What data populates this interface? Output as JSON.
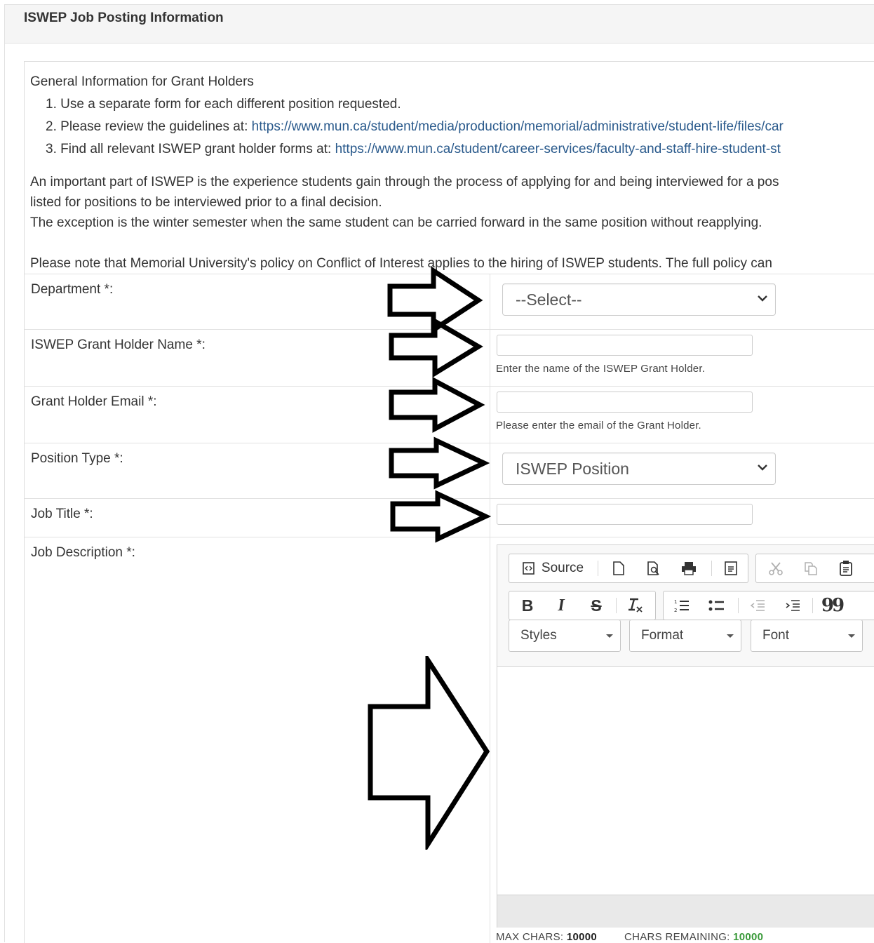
{
  "panel": {
    "title": "ISWEP Job Posting Information"
  },
  "info": {
    "heading": "General Information for Grant Holders",
    "items": [
      {
        "num": "1.",
        "text": "Use a separate form for each different position requested.",
        "link": ""
      },
      {
        "num": "2.",
        "text": "Please review the guidelines at: ",
        "link": "https://www.mun.ca/student/media/production/memorial/administrative/student-life/files/car"
      },
      {
        "num": "3.",
        "text": "Find all relevant ISWEP grant holder forms at: ",
        "link": "https://www.mun.ca/student/career-services/faculty-and-staff-hire-student-st"
      }
    ],
    "para1_line1": "An important part of ISWEP is the experience students gain through the process of applying for and being interviewed for a pos",
    "para1_line2": "listed for positions to be interviewed prior to a final decision.",
    "para1_line3": "The exception is the winter semester when the same student can be carried forward in the same position without reapplying.",
    "para2": "Please note that Memorial University's policy on Conflict of Interest applies to the hiring of ISWEP students.  The full policy can"
  },
  "fields": {
    "department": {
      "label": "Department *:",
      "selected": "--Select--"
    },
    "grant_holder_name": {
      "label": "ISWEP Grant Holder Name *:",
      "value": "",
      "help": "Enter the name of the ISWEP Grant Holder."
    },
    "grant_holder_email": {
      "label": "Grant Holder Email *:",
      "value": "",
      "help": "Please enter the email of the Grant Holder."
    },
    "position_type": {
      "label": "Position Type *:",
      "selected": "ISWEP Position"
    },
    "job_title": {
      "label": "Job Title *:",
      "value": ""
    },
    "job_description": {
      "label": "Job Description *:"
    }
  },
  "editor": {
    "source_label": "Source",
    "styles_label": "Styles",
    "format_label": "Format",
    "font_label": "Font",
    "bold_glyph": "B",
    "italic_glyph": "I",
    "strike_glyph": "S",
    "blockquote_glyph": "99"
  },
  "counter": {
    "max_label": "MAX CHARS:",
    "max_value": "10000",
    "remaining_label": "CHARS REMAINING:",
    "remaining_value": "10000"
  },
  "colors": {
    "link": "#2a5a8c",
    "remaining": "#3a9a3a",
    "panel_bg": "#f5f5f5"
  },
  "icons": [
    "new-page-icon",
    "preview-icon",
    "print-icon",
    "templates-icon",
    "cut-icon",
    "copy-icon",
    "paste-icon",
    "remove-format-icon",
    "numbered-list-icon",
    "bulleted-list-icon",
    "outdent-icon",
    "indent-icon",
    "arrow-right-icon"
  ]
}
